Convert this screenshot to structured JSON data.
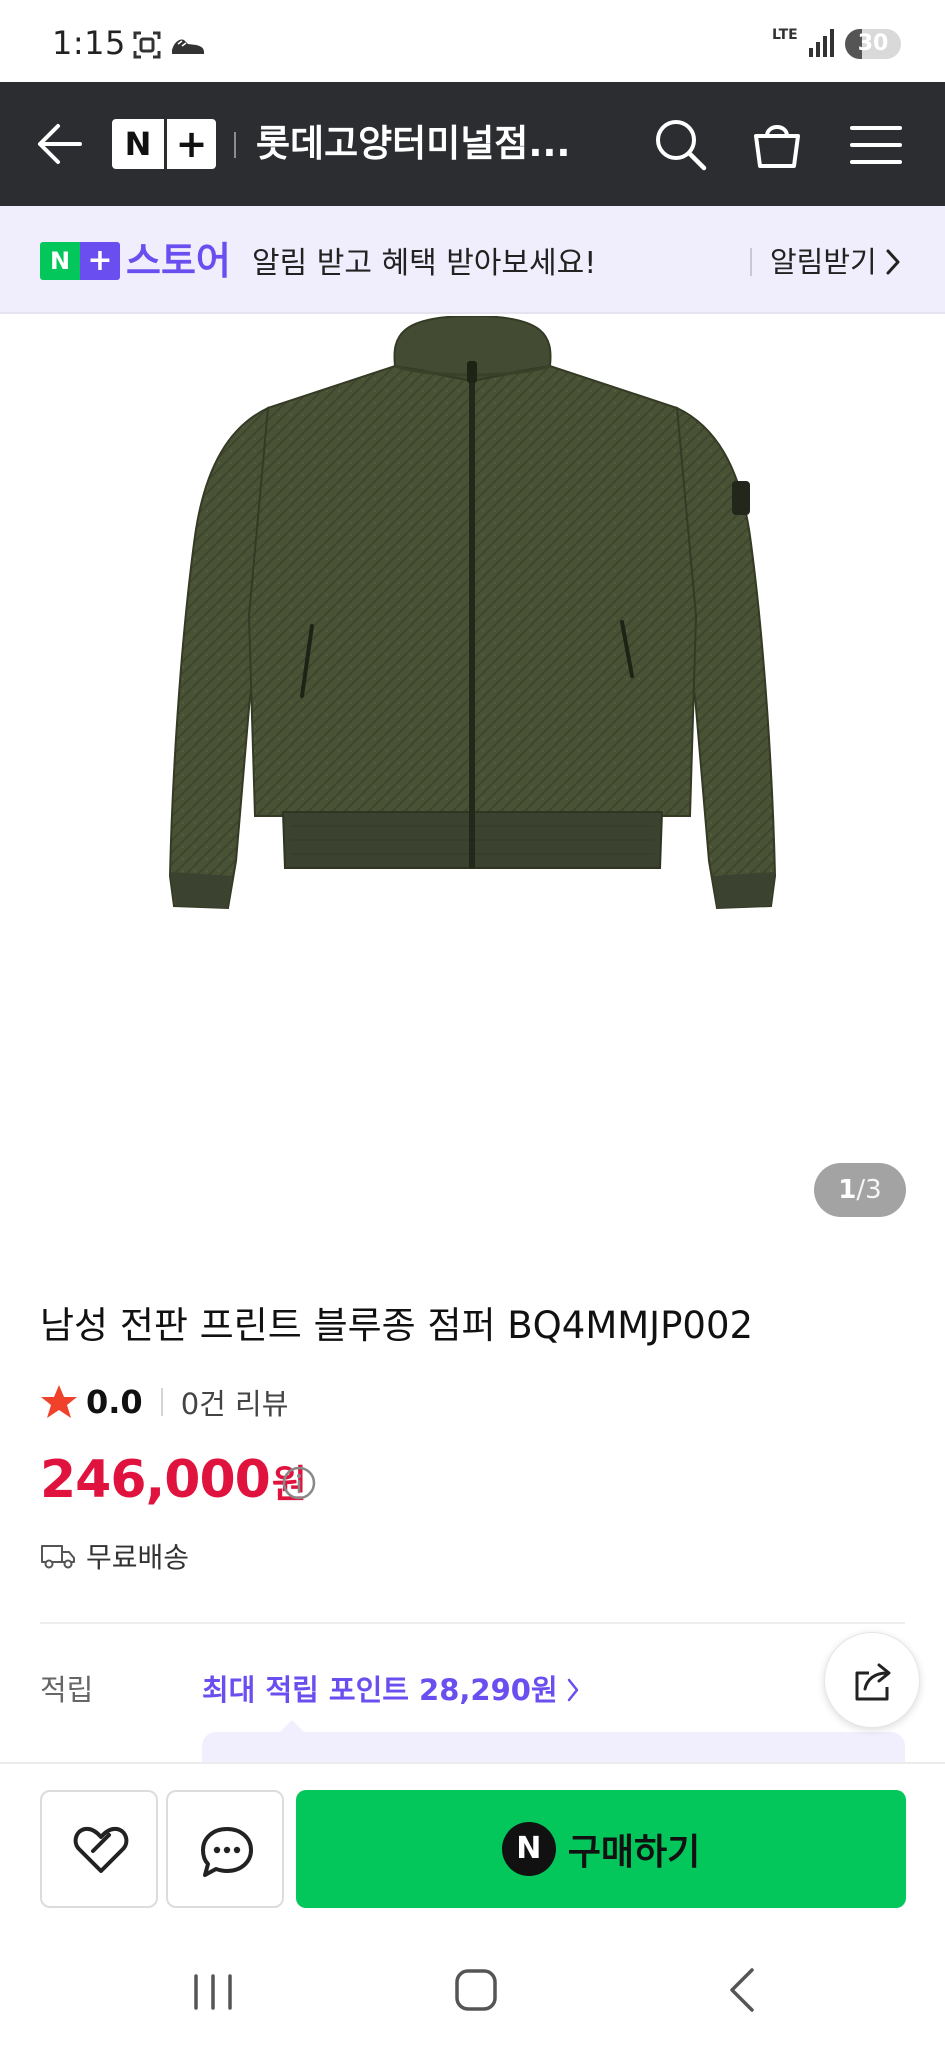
{
  "status_bar": {
    "time": "1:15",
    "network": "LTE",
    "battery": "30"
  },
  "top_nav": {
    "logo_n": "N",
    "logo_plus": "+",
    "title": "롯데고양터미널점..."
  },
  "store_banner": {
    "badge_n": "N",
    "badge_plus": "+",
    "store_name": "스토어",
    "message": "알림 받고 혜택 받아보세요!",
    "alert_label": "알림받기"
  },
  "gallery": {
    "current": "1",
    "separator": "/",
    "total": "3"
  },
  "product": {
    "title": "남성 전판 프린트 블루종 점퍼 BQ4MMJP002",
    "rating": "0.0",
    "reviews": "0건 리뷰",
    "price": "246,000",
    "price_unit": "원",
    "shipping": "무료배송",
    "points_label": "적립",
    "points_link": "최대 적립 포인트 28,290원"
  },
  "bottom_bar": {
    "buy_badge": "N",
    "buy_label": "구매하기"
  },
  "colors": {
    "nav_bg": "#2b2d31",
    "naver_green": "#03c75a",
    "store_purple": "#6b4ef0",
    "price_red": "#e0123e",
    "banner_bg": "#f0eefc",
    "jacket_olive": "#4a5236"
  },
  "icons": {
    "back": "arrow-left-icon",
    "search": "search-icon",
    "cart": "shopping-bag-icon",
    "menu": "hamburger-menu-icon",
    "star": "star-icon",
    "info": "info-icon",
    "shipping": "truck-icon",
    "share": "share-icon",
    "wish": "heart-icon",
    "talk": "chat-bubble-icon"
  }
}
